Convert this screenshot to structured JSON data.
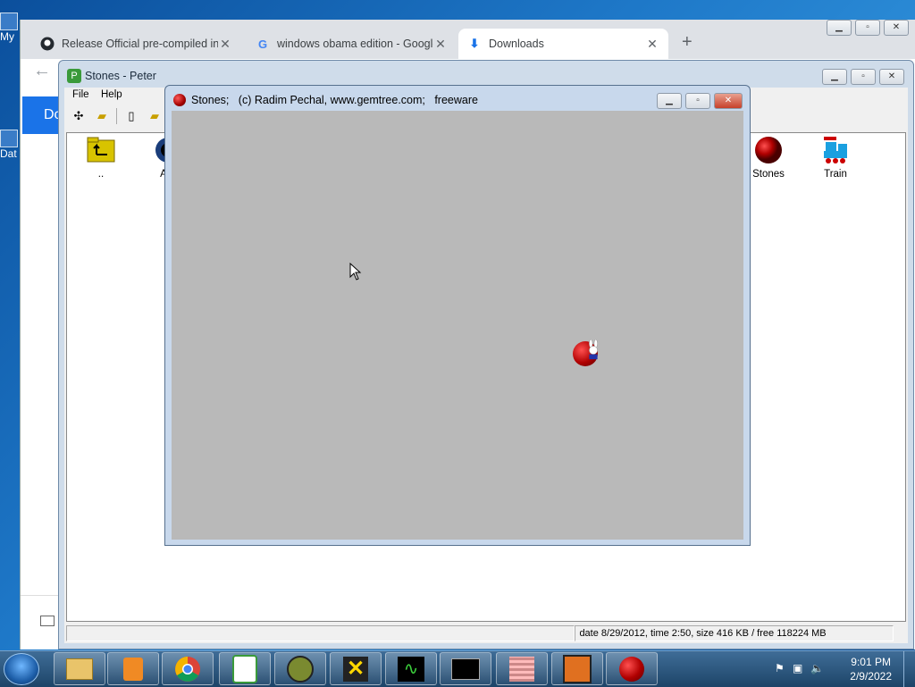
{
  "desktop": {
    "icons": [
      {
        "label": "My"
      },
      {
        "label": "Dat"
      }
    ]
  },
  "browser": {
    "tabs": [
      {
        "title": "Release Official pre-compiled ins",
        "icon": "github-icon"
      },
      {
        "title": "windows obama edition - Google",
        "icon": "google-icon"
      },
      {
        "title": "Downloads",
        "icon": "download-icon",
        "active": true
      }
    ],
    "page_header_partial": "Do"
  },
  "peter": {
    "title": "Stones - Peter",
    "menu": [
      "File",
      "Help"
    ],
    "items": [
      {
        "label": "..",
        "icon": "folder-up-icon"
      },
      {
        "label": "A",
        "icon": "app-icon"
      },
      {
        "label": "Stones",
        "icon": "stone-icon"
      },
      {
        "label": "Train",
        "icon": "train-icon"
      }
    ],
    "status": "date 8/29/2012, time 2:50, size 416 KB / free 118224 MB"
  },
  "stones": {
    "title": "Stones;   (c) Radim Pechal, www.gemtree.com;   freeware"
  },
  "taskbar": {
    "time": "9:01 PM",
    "date": "2/9/2022",
    "buttons": [
      "explorer",
      "media-player",
      "chrome",
      "peter-rabbit",
      "alien",
      "yellow-x",
      "oscilloscope",
      "cmd",
      "grid",
      "puzzle",
      "stones"
    ]
  },
  "colors": {
    "accent": "#1a73e8",
    "playfield": "#b9b9b9",
    "stone": "#b00000"
  }
}
